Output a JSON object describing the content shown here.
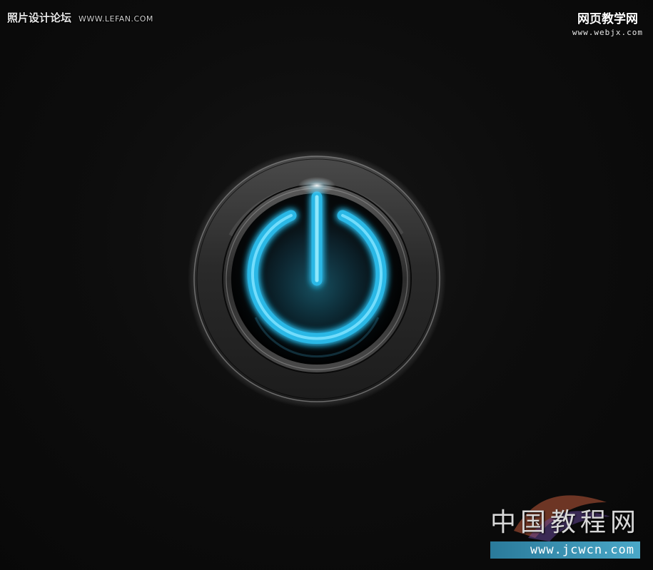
{
  "watermarks": {
    "top_left_name": "照片设计论坛",
    "top_left_url": "WWW.LEFAN.COM",
    "top_right_name": "网页教学网",
    "top_right_url": "www.webjx.com",
    "bottom_right_name": "中国教程网",
    "bottom_right_url": "www.jcwcn.com"
  },
  "colors": {
    "background": "#0b0b0b",
    "glow_accent": "#2ec8f0",
    "ring_metal": "#3a3a3a"
  },
  "icon": {
    "main": "power-icon"
  }
}
